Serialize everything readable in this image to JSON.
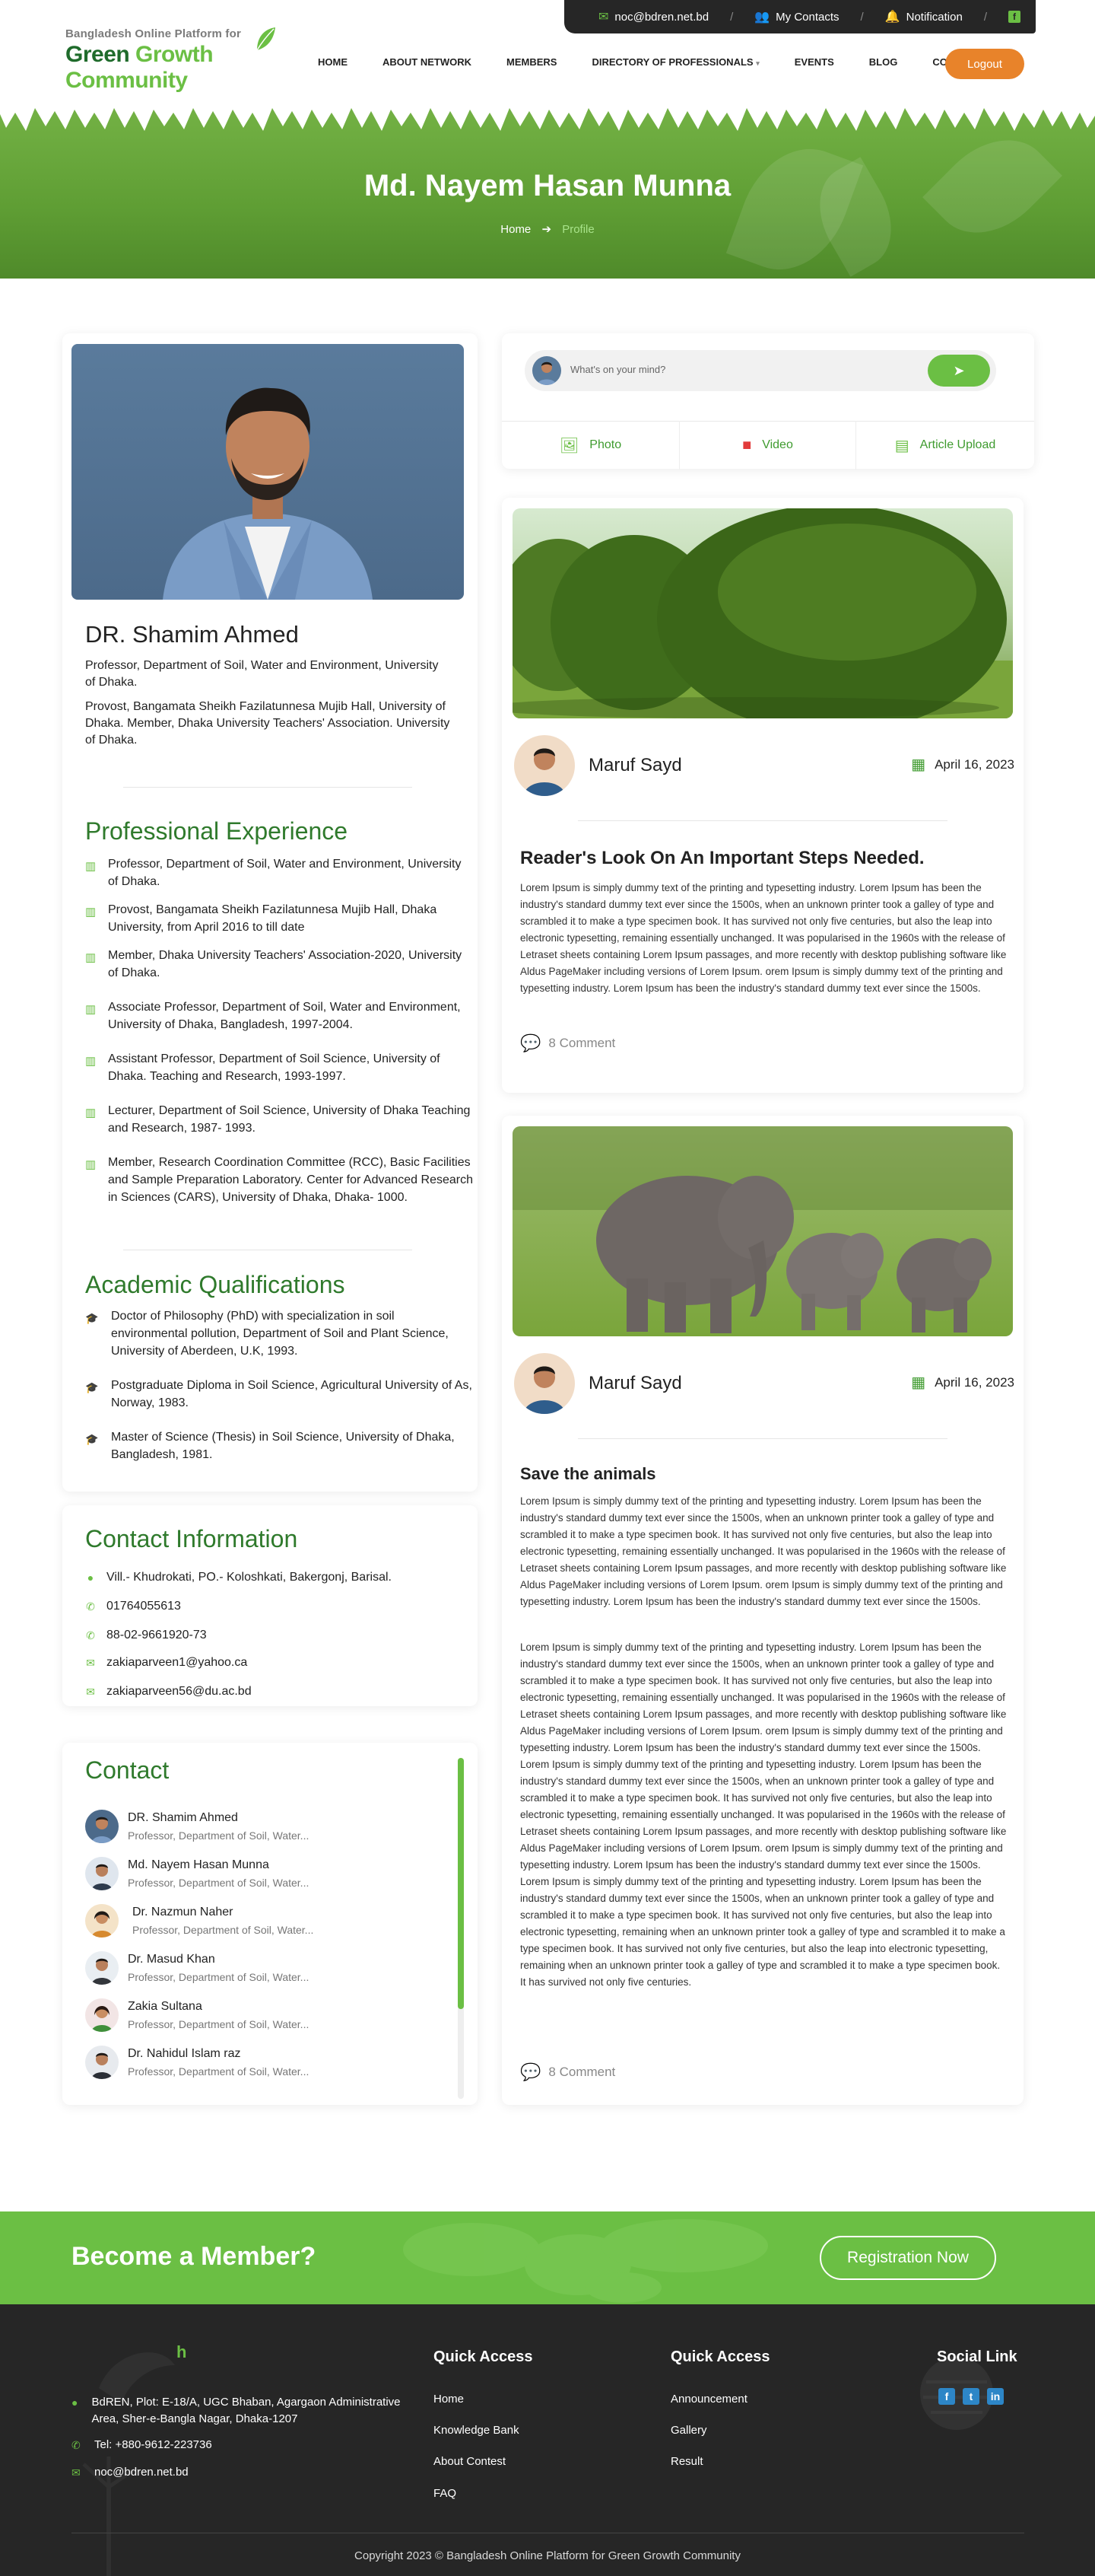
{
  "topbar": {
    "email": "noc@bdren.net.bd",
    "contacts": "My Contacts",
    "notification": "Notification"
  },
  "header": {
    "logo_small": "Bangladesh Online Platform for",
    "logo_big_a": "Green ",
    "logo_big_b": "Growth Community",
    "nav": [
      "HOME",
      "ABOUT NETWORK",
      "MEMBERS",
      "DIRECTORY OF PROFESSIONALS",
      "EVENTS",
      "BLOG",
      "CONTACT US"
    ],
    "logout": "Logout"
  },
  "hero": {
    "title": "Md. Nayem Hasan Munna",
    "crumb_home": "Home",
    "crumb_current": "Profile"
  },
  "profile": {
    "name": "DR. Shamim Ahmed",
    "position": "Professor, Department of Soil, Water and Environment, University of Dhaka.",
    "provost": "Provost, Bangamata Sheikh Fazilatunnesa Mujib Hall,  University of Dhaka. Member, Dhaka University Teachers' Association. University of Dhaka."
  },
  "experience": {
    "title": "Professional Experience",
    "items": [
      "Professor, Department of Soil, Water and Environment, University of Dhaka.",
      "Provost, Bangamata Sheikh Fazilatunnesa Mujib Hall, Dhaka University, from April 2016    to till date",
      "Member, Dhaka University Teachers' Association-2020, University of Dhaka.",
      "Associate Professor, Department of Soil, Water and Environment, University of Dhaka,    Bangladesh, 1997-2004.",
      "Assistant Professor, Department of Soil Science, University of Dhaka. Teaching and    Research, 1993-1997.",
      "Lecturer, Department of Soil Science, University of Dhaka Teaching and Research, 1987-    1993.",
      "Member, Research Coordination Committee (RCC), Basic Facilities and Sample    Preparation Laboratory. Center for Advanced Research in Sciences (CARS), University of Dhaka, Dhaka- 1000."
    ]
  },
  "academic": {
    "title": "Academic Qualifications",
    "items": [
      "Doctor of Philosophy (PhD) with specialization in soil environmental pollution,    Department of Soil and Plant Science, University of Aberdeen, U.K, 1993.",
      "Postgraduate Diploma in Soil Science, Agricultural University of As, Norway, 1983.",
      "Master of Science (Thesis) in Soil Science, University of Dhaka, Bangladesh, 1981."
    ]
  },
  "contact_info": {
    "title": "Contact Information",
    "address": "Vill.- Khudrokati, PO.- Koloshkati, Bakergonj, Barisal.",
    "mobile": "01764055613",
    "phone": "88-02-9661920-73",
    "email1": "zakiaparveen1@yahoo.ca",
    "email2": "zakiaparveen56@du.ac.bd"
  },
  "contacts": {
    "title": "Contact",
    "items": [
      {
        "name": "DR. Shamim Ahmed",
        "role": "Professor, Department of Soil, Water..."
      },
      {
        "name": "Md. Nayem Hasan Munna",
        "role": "Professor, Department of Soil, Water..."
      },
      {
        "name": "Dr. Nazmun Naher",
        "role": "Professor, Department of Soil, Water..."
      },
      {
        "name": "Dr. Masud Khan",
        "role": "Professor, Department of Soil, Water..."
      },
      {
        "name": "Zakia Sultana",
        "role": "Professor, Department of Soil, Water..."
      },
      {
        "name": "Dr. Nahidul Islam raz",
        "role": "Professor, Department of Soil, Water..."
      }
    ]
  },
  "composer": {
    "placeholder": "What's on your mind?",
    "photo": "Photo",
    "video": "Video",
    "article": "Article Upload"
  },
  "posts": [
    {
      "author": "Maruf Sayd",
      "date": "April 16, 2023",
      "title": "Reader's Look On An Important Steps Needed.",
      "body": "Lorem Ipsum is simply dummy text of the printing and typesetting industry. Lorem Ipsum has been the industry's standard dummy text ever since the 1500s, when an unknown printer took a galley of type and scrambled it to make a type specimen book. It has survived not only five centuries, but also the leap into electronic typesetting, remaining essentially unchanged. It was popularised in the 1960s with the release of Letraset sheets containing Lorem Ipsum passages, and more recently with desktop publishing software like Aldus PageMaker including versions of Lorem Ipsum. orem Ipsum is simply dummy text of the printing and typesetting industry. Lorem Ipsum has been the industry's standard dummy text ever since the 1500s.",
      "comments": "8 Comment"
    },
    {
      "author": "Maruf Sayd",
      "date": "April 16, 2023",
      "title": "Save the animals",
      "body": "Lorem Ipsum is simply dummy text of the printing and typesetting industry. Lorem Ipsum has been the industry's standard dummy text ever since the 1500s, when an unknown printer took a galley of type and scrambled it to make a type specimen book. It has survived not only five centuries, but also the leap into electronic typesetting, remaining essentially unchanged. It was popularised in the 1960s with the release of Letraset sheets containing Lorem Ipsum passages, and more recently with desktop publishing software like Aldus PageMaker including versions of Lorem Ipsum. orem Ipsum is simply dummy text of the printing and typesetting industry. Lorem Ipsum has been the industry's standard dummy text ever since the 1500s.",
      "body2": "Lorem Ipsum is simply dummy text of the printing and typesetting industry. Lorem Ipsum has been the industry's standard dummy text ever since the 1500s, when an unknown printer took a galley of type and scrambled it to make a type specimen book. It has survived not only five centuries, but also the leap into electronic typesetting, remaining essentially unchanged. It was popularised in the 1960s with the release of Letraset sheets containing Lorem Ipsum passages, and more recently with desktop publishing software like Aldus PageMaker including versions of Lorem Ipsum. orem Ipsum is simply dummy text of the printing and typesetting industry. Lorem Ipsum has been the industry's standard dummy text ever since the 1500s.  Lorem Ipsum is simply dummy text of the printing and typesetting industry. Lorem Ipsum has been the industry's standard dummy text ever since the 1500s, when an unknown printer took a galley of type and scrambled it to make a type specimen book. It has survived not only five centuries, but also the leap into electronic typesetting, remaining essentially unchanged. It was popularised in the 1960s with the release of Letraset sheets containing Lorem Ipsum passages, and more recently with desktop publishing software like Aldus PageMaker including versions of Lorem Ipsum. orem Ipsum is simply dummy text of the printing and typesetting industry. Lorem Ipsum has been the industry's standard dummy text ever since the 1500s.  Lorem Ipsum is simply dummy text of the printing and typesetting industry. Lorem Ipsum has been the industry's standard dummy text ever since the 1500s, when an unknown printer took a galley of type and scrambled it to make a type specimen book. It has survived not only five centuries, but also the leap into electronic typesetting, remaining when an unknown printer took a galley of type and scrambled it to make a type specimen book. It has survived not only five centuries, but also the leap into electronic typesetting, remaining when an unknown printer took a galley of type and scrambled it to make a type specimen book. It has survived not only five centuries.",
      "comments": "8 Comment"
    }
  ],
  "banner": {
    "title": "Become a Member?",
    "button": "Registration Now"
  },
  "footer": {
    "address": "BdREN, Plot: E-18/A, UGC Bhaban, Agargaon Administrative Area, Sher-e-Bangla Nagar, Dhaka-1207",
    "tel": "Tel: +880-9612-223736",
    "email": "noc@bdren.net.bd",
    "quick_access_1": {
      "title": "Quick Access",
      "links": [
        "Home",
        "Knowledge Bank",
        "About Contest",
        "FAQ"
      ]
    },
    "quick_access_2": {
      "title": "Quick Access",
      "links": [
        "Announcement",
        "Gallery",
        "Result"
      ]
    },
    "social_title": "Social Link",
    "copyright": "Copyright 2023 © Bangladesh Online Platform for Green Growth Community"
  },
  "colors": {
    "brand_green": "#6bbf44",
    "dark_green": "#2f7a2c",
    "accent_orange": "#e8832a",
    "dark": "#262626"
  }
}
